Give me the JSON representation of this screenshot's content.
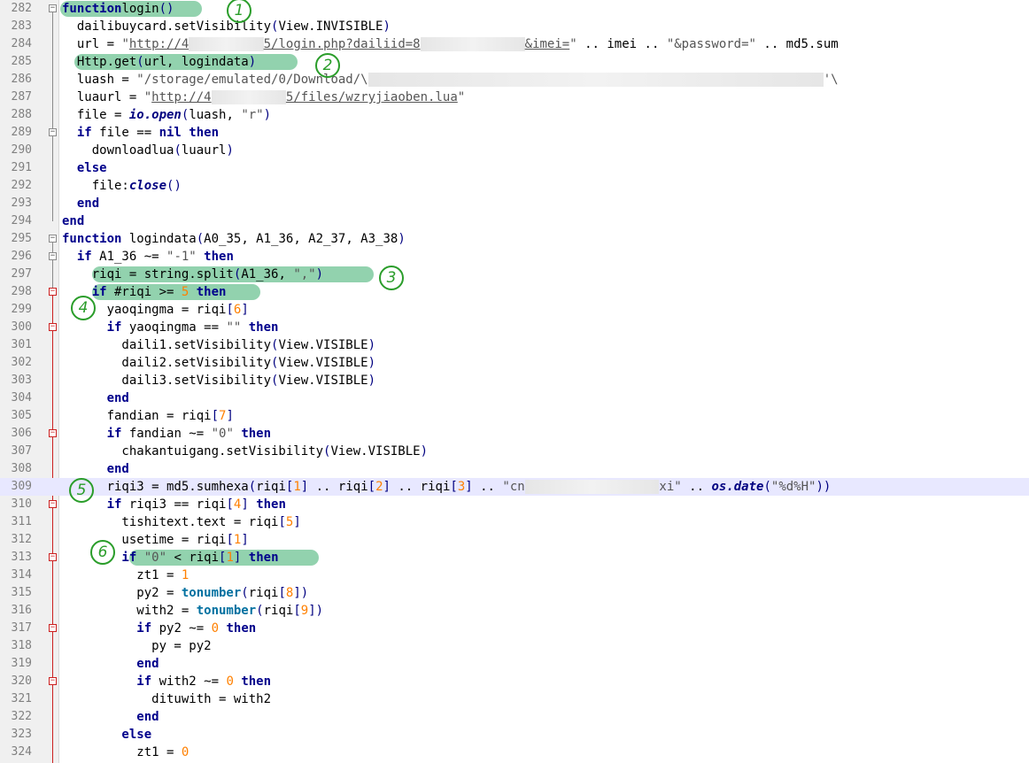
{
  "editor": {
    "language": "lua",
    "current_line": 309,
    "colors": {
      "highlight": "#7fcaa0",
      "annotation": "#2a9d2a",
      "keyword": "#00008b",
      "number": "#ff8000"
    }
  },
  "annotations": [
    "1",
    "2",
    "3",
    "4",
    "5",
    "6"
  ],
  "lines": [
    {
      "n": "282",
      "fold": "minus",
      "segs": [
        [
          "kw",
          "function"
        ],
        [
          "",
          ""
        ],
        [
          "",
          "login"
        ],
        [
          "brk",
          "()"
        ]
      ]
    },
    {
      "n": "283",
      "segs": [
        [
          "",
          "  dailibuycard.setVisibility"
        ],
        [
          "brk",
          "("
        ],
        [
          "",
          "View.INVISIBLE"
        ],
        [
          "brk",
          ")"
        ]
      ]
    },
    {
      "n": "284",
      "segs": [
        [
          "",
          "  url = "
        ],
        [
          "str",
          "\""
        ],
        [
          "url",
          "http://4"
        ],
        [
          "blur",
          "          "
        ],
        [
          "url",
          "5/login.php?dailiid=8"
        ],
        [
          "blur",
          "              "
        ],
        [
          "url",
          "&imei="
        ],
        [
          "str",
          "\""
        ],
        [
          "",
          " .. imei .. "
        ],
        [
          "str",
          "\"&password=\""
        ],
        [
          "",
          " .. md5.sum"
        ]
      ]
    },
    {
      "n": "285",
      "segs": [
        [
          "",
          "  Http.get"
        ],
        [
          "brk",
          "("
        ],
        [
          "",
          "url, logindata"
        ],
        [
          "brk",
          ")"
        ]
      ]
    },
    {
      "n": "286",
      "segs": [
        [
          "",
          "  luash = "
        ],
        [
          "str",
          "\"/storage/emulated/0/Download/\\"
        ],
        [
          "blur",
          "                                                             "
        ],
        [
          "str",
          "'\\"
        ]
      ]
    },
    {
      "n": "287",
      "segs": [
        [
          "",
          "  luaurl = "
        ],
        [
          "str",
          "\""
        ],
        [
          "url",
          "http://4"
        ],
        [
          "blur",
          "          "
        ],
        [
          "url",
          "5/files/wzryjiaoben.lua"
        ],
        [
          "str",
          "\""
        ]
      ]
    },
    {
      "n": "288",
      "segs": [
        [
          "",
          "  file = "
        ],
        [
          "fn",
          "io.open"
        ],
        [
          "brk",
          "("
        ],
        [
          "",
          "luash, "
        ],
        [
          "str",
          "\"r\""
        ],
        [
          "brk",
          ")"
        ]
      ]
    },
    {
      "n": "289",
      "fold": "minus",
      "segs": [
        [
          "kw",
          "  if"
        ],
        [
          "",
          " file == "
        ],
        [
          "kw",
          "nil"
        ],
        [
          "kw",
          " then"
        ]
      ]
    },
    {
      "n": "290",
      "segs": [
        [
          "",
          "    downloadlua"
        ],
        [
          "brk",
          "("
        ],
        [
          "",
          "luaurl"
        ],
        [
          "brk",
          ")"
        ]
      ]
    },
    {
      "n": "291",
      "segs": [
        [
          "kw",
          "  else"
        ]
      ]
    },
    {
      "n": "292",
      "segs": [
        [
          "",
          "    file:"
        ],
        [
          "fn",
          "close"
        ],
        [
          "brk",
          "()"
        ]
      ]
    },
    {
      "n": "293",
      "segs": [
        [
          "kw",
          "  end"
        ]
      ]
    },
    {
      "n": "294",
      "segs": [
        [
          "kw",
          "end"
        ]
      ]
    },
    {
      "n": "295",
      "fold": "minus",
      "segs": [
        [
          "kw",
          "function"
        ],
        [
          "",
          " logindata"
        ],
        [
          "brk",
          "("
        ],
        [
          "",
          "A0_35, A1_36, A2_37, A3_38"
        ],
        [
          "brk",
          ")"
        ]
      ]
    },
    {
      "n": "296",
      "fold": "minus",
      "segs": [
        [
          "kw",
          "  if"
        ],
        [
          "",
          " A1_36 ~= "
        ],
        [
          "str",
          "\"-1\""
        ],
        [
          "kw",
          " then"
        ]
      ]
    },
    {
      "n": "297",
      "segs": [
        [
          "",
          "    riqi = string.split"
        ],
        [
          "brk",
          "("
        ],
        [
          "",
          "A1_36, "
        ],
        [
          "str",
          "\",\""
        ],
        [
          "brk",
          ")"
        ]
      ]
    },
    {
      "n": "298",
      "fold": "minus-red",
      "segs": [
        [
          "kw",
          "    if"
        ],
        [
          "",
          " #riqi >= "
        ],
        [
          "num",
          "5"
        ],
        [
          "kw",
          " then"
        ]
      ]
    },
    {
      "n": "299",
      "segs": [
        [
          "",
          "      yaoqingma = riqi"
        ],
        [
          "brk",
          "["
        ],
        [
          "num",
          "6"
        ],
        [
          "brk",
          "]"
        ]
      ]
    },
    {
      "n": "300",
      "fold": "minus-red",
      "segs": [
        [
          "kw",
          "      if"
        ],
        [
          "",
          " yaoqingma == "
        ],
        [
          "str",
          "\"\""
        ],
        [
          "kw",
          " then"
        ]
      ]
    },
    {
      "n": "301",
      "segs": [
        [
          "",
          "        daili1.setVisibility"
        ],
        [
          "brk",
          "("
        ],
        [
          "",
          "View.VISIBLE"
        ],
        [
          "brk",
          ")"
        ]
      ]
    },
    {
      "n": "302",
      "segs": [
        [
          "",
          "        daili2.setVisibility"
        ],
        [
          "brk",
          "("
        ],
        [
          "",
          "View.VISIBLE"
        ],
        [
          "brk",
          ")"
        ]
      ]
    },
    {
      "n": "303",
      "segs": [
        [
          "",
          "        daili3.setVisibility"
        ],
        [
          "brk",
          "("
        ],
        [
          "",
          "View.VISIBLE"
        ],
        [
          "brk",
          ")"
        ]
      ]
    },
    {
      "n": "304",
      "segs": [
        [
          "kw",
          "      end"
        ]
      ]
    },
    {
      "n": "305",
      "segs": [
        [
          "",
          "      fandian = riqi"
        ],
        [
          "brk",
          "["
        ],
        [
          "num",
          "7"
        ],
        [
          "brk",
          "]"
        ]
      ]
    },
    {
      "n": "306",
      "fold": "minus-red",
      "segs": [
        [
          "kw",
          "      if"
        ],
        [
          "",
          " fandian ~= "
        ],
        [
          "str",
          "\"0\""
        ],
        [
          "kw",
          " then"
        ]
      ]
    },
    {
      "n": "307",
      "segs": [
        [
          "",
          "        chakantuigang.setVisibility"
        ],
        [
          "brk",
          "("
        ],
        [
          "",
          "View.VISIBLE"
        ],
        [
          "brk",
          ")"
        ]
      ]
    },
    {
      "n": "308",
      "segs": [
        [
          "kw",
          "      end"
        ]
      ]
    },
    {
      "n": "309",
      "segs": [
        [
          "",
          "      riqi3 = md5.sumhexa"
        ],
        [
          "brk",
          "("
        ],
        [
          "",
          "riqi"
        ],
        [
          "brk",
          "["
        ],
        [
          "num",
          "1"
        ],
        [
          "brk",
          "]"
        ],
        [
          "",
          " .. riqi"
        ],
        [
          "brk",
          "["
        ],
        [
          "num",
          "2"
        ],
        [
          "brk",
          "]"
        ],
        [
          "",
          " .. riqi"
        ],
        [
          "brk",
          "["
        ],
        [
          "num",
          "3"
        ],
        [
          "brk",
          "]"
        ],
        [
          "",
          " .. "
        ],
        [
          "str",
          "\"cn"
        ],
        [
          "blur",
          "                  "
        ],
        [
          "str",
          "xi\""
        ],
        [
          "",
          " .. "
        ],
        [
          "fn",
          "os.date"
        ],
        [
          "brk",
          "("
        ],
        [
          "str",
          "\"%d%H\""
        ],
        [
          "brk",
          "))"
        ]
      ]
    },
    {
      "n": "310",
      "fold": "minus-red",
      "segs": [
        [
          "kw",
          "      if"
        ],
        [
          "",
          " riqi3 == riqi"
        ],
        [
          "brk",
          "["
        ],
        [
          "num",
          "4"
        ],
        [
          "brk",
          "]"
        ],
        [
          "kw",
          " then"
        ]
      ]
    },
    {
      "n": "311",
      "segs": [
        [
          "",
          "        tishitext.text = riqi"
        ],
        [
          "brk",
          "["
        ],
        [
          "num",
          "5"
        ],
        [
          "brk",
          "]"
        ]
      ]
    },
    {
      "n": "312",
      "segs": [
        [
          "",
          "        usetime = riqi"
        ],
        [
          "brk",
          "["
        ],
        [
          "num",
          "1"
        ],
        [
          "brk",
          "]"
        ]
      ]
    },
    {
      "n": "313",
      "fold": "minus-red",
      "segs": [
        [
          "kw",
          "        if"
        ],
        [
          "",
          " "
        ],
        [
          "str",
          "\"0\""
        ],
        [
          "",
          " < riqi"
        ],
        [
          "brk",
          "["
        ],
        [
          "num",
          "1"
        ],
        [
          "brk",
          "]"
        ],
        [
          "kw",
          " then"
        ]
      ]
    },
    {
      "n": "314",
      "segs": [
        [
          "",
          "          zt1 = "
        ],
        [
          "num",
          "1"
        ]
      ]
    },
    {
      "n": "315",
      "segs": [
        [
          "",
          "          py2 = "
        ],
        [
          "bfn",
          "tonumber"
        ],
        [
          "brk",
          "("
        ],
        [
          "",
          "riqi"
        ],
        [
          "brk",
          "["
        ],
        [
          "num",
          "8"
        ],
        [
          "brk",
          "])"
        ]
      ]
    },
    {
      "n": "316",
      "segs": [
        [
          "",
          "          with2 = "
        ],
        [
          "bfn",
          "tonumber"
        ],
        [
          "brk",
          "("
        ],
        [
          "",
          "riqi"
        ],
        [
          "brk",
          "["
        ],
        [
          "num",
          "9"
        ],
        [
          "brk",
          "])"
        ]
      ]
    },
    {
      "n": "317",
      "fold": "minus-red",
      "segs": [
        [
          "kw",
          "          if"
        ],
        [
          "",
          " py2 ~= "
        ],
        [
          "num",
          "0"
        ],
        [
          "kw",
          " then"
        ]
      ]
    },
    {
      "n": "318",
      "segs": [
        [
          "",
          "            py = py2"
        ]
      ]
    },
    {
      "n": "319",
      "segs": [
        [
          "kw",
          "          end"
        ]
      ]
    },
    {
      "n": "320",
      "fold": "minus-red",
      "segs": [
        [
          "kw",
          "          if"
        ],
        [
          "",
          " with2 ~= "
        ],
        [
          "num",
          "0"
        ],
        [
          "kw",
          " then"
        ]
      ]
    },
    {
      "n": "321",
      "segs": [
        [
          "",
          "            dituwith = with2"
        ]
      ]
    },
    {
      "n": "322",
      "segs": [
        [
          "kw",
          "          end"
        ]
      ]
    },
    {
      "n": "323",
      "segs": [
        [
          "kw",
          "        else"
        ]
      ]
    },
    {
      "n": "324",
      "segs": [
        [
          "",
          "          zt1 = "
        ],
        [
          "num",
          "0"
        ]
      ]
    }
  ]
}
